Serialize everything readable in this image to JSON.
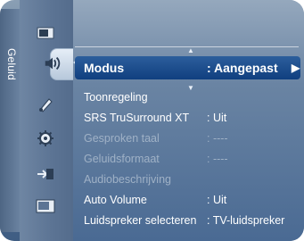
{
  "sidebar": {
    "label": "Geluid",
    "icons": [
      {
        "name": "picture-icon"
      },
      {
        "name": "sound-icon"
      },
      {
        "name": "channel-icon"
      },
      {
        "name": "setup-icon"
      },
      {
        "name": "input-icon"
      },
      {
        "name": "application-icon"
      }
    ]
  },
  "menu": {
    "nav": {
      "up": "▲",
      "down": "▼"
    },
    "items": [
      {
        "label": "Modus",
        "value": ": Aangepast",
        "selected": true,
        "disabled": false,
        "arrow": "▶"
      },
      {
        "label": "Toonregeling",
        "value": "",
        "selected": false,
        "disabled": false
      },
      {
        "label": "SRS TruSurround XT",
        "value": ": Uit",
        "selected": false,
        "disabled": false
      },
      {
        "label": "Gesproken taal",
        "value": ": ----",
        "selected": false,
        "disabled": true
      },
      {
        "label": "Geluidsformaat",
        "value": ": ----",
        "selected": false,
        "disabled": true
      },
      {
        "label": "Audiobeschrijving",
        "value": "",
        "selected": false,
        "disabled": true
      },
      {
        "label": "Auto Volume",
        "value": ": Uit",
        "selected": false,
        "disabled": false
      },
      {
        "label": "Luidspreker selecteren",
        "value": ": TV-luidspreker",
        "selected": false,
        "disabled": false
      }
    ]
  }
}
